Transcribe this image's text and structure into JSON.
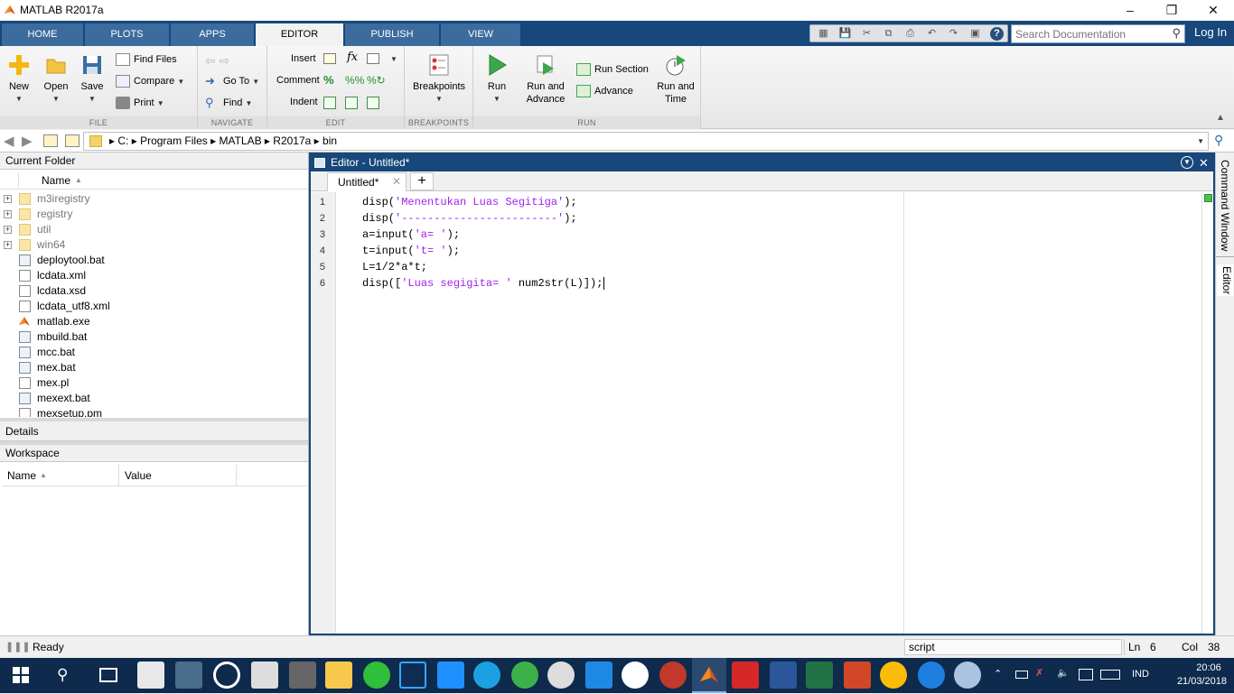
{
  "window": {
    "title": "MATLAB R2017a"
  },
  "tabs": [
    "HOME",
    "PLOTS",
    "APPS",
    "EDITOR",
    "PUBLISH",
    "VIEW"
  ],
  "search": {
    "placeholder": "Search Documentation"
  },
  "login": "Log In",
  "ribbon": {
    "file": {
      "label": "FILE",
      "new": "New",
      "open": "Open",
      "save": "Save",
      "find_files": "Find Files",
      "compare": "Compare",
      "print": "Print"
    },
    "navigate": {
      "label": "NAVIGATE",
      "go_to": "Go To",
      "find": "Find"
    },
    "edit": {
      "label": "EDIT",
      "insert": "Insert",
      "comment": "Comment",
      "indent": "Indent",
      "fx": "fx"
    },
    "breakpoints": {
      "label": "BREAKPOINTS",
      "breakpoints": "Breakpoints"
    },
    "run": {
      "label": "RUN",
      "run": "Run",
      "run_advance": "Run and Advance",
      "run_section": "Run Section",
      "advance": "Advance",
      "run_time": "Run and Time"
    }
  },
  "path": [
    "C:",
    "Program Files",
    "MATLAB",
    "R2017a",
    "bin"
  ],
  "current_folder": {
    "title": "Current Folder",
    "name_header": "Name",
    "items": [
      {
        "name": "m3iregistry",
        "type": "folder"
      },
      {
        "name": "registry",
        "type": "folder"
      },
      {
        "name": "util",
        "type": "folder"
      },
      {
        "name": "win64",
        "type": "folder"
      },
      {
        "name": "deploytool.bat",
        "type": "bat"
      },
      {
        "name": "lcdata.xml",
        "type": "file"
      },
      {
        "name": "lcdata.xsd",
        "type": "file"
      },
      {
        "name": "lcdata_utf8.xml",
        "type": "file"
      },
      {
        "name": "matlab.exe",
        "type": "exe"
      },
      {
        "name": "mbuild.bat",
        "type": "bat"
      },
      {
        "name": "mcc.bat",
        "type": "bat"
      },
      {
        "name": "mex.bat",
        "type": "bat"
      },
      {
        "name": "mex.pl",
        "type": "file"
      },
      {
        "name": "mexext.bat",
        "type": "bat"
      },
      {
        "name": "mexsetup.pm",
        "type": "file"
      }
    ]
  },
  "details": "Details",
  "workspace": {
    "title": "Workspace",
    "name_header": "Name",
    "value_header": "Value"
  },
  "editor": {
    "title": "Editor - Untitled*",
    "tab": "Untitled*",
    "lines": [
      {
        "num": "1",
        "pre": "disp(",
        "str": "'Menentukan Luas Segitiga'",
        "post": ");"
      },
      {
        "num": "2",
        "pre": "disp(",
        "str": "'------------------------'",
        "post": ");"
      },
      {
        "num": "3",
        "pre": "a=input(",
        "str": "'a= '",
        "post": ");"
      },
      {
        "num": "4",
        "pre": "t=input(",
        "str": "'t= '",
        "post": ");"
      },
      {
        "num": "5",
        "pre": "L=1/2*a*t;",
        "str": "",
        "post": ""
      },
      {
        "num": "6",
        "pre": "disp([",
        "str": "'Luas segigita= '",
        "post": " num2str(L)]);"
      }
    ]
  },
  "side_tabs": {
    "command_window": "Command Window",
    "editor": "Editor"
  },
  "status": {
    "ready": "Ready",
    "type": "script",
    "ln_label": "Ln",
    "ln": "6",
    "col_label": "Col",
    "col": "38"
  },
  "taskbar": {
    "lang": "IND",
    "time": "20:06",
    "date": "21/03/2018"
  }
}
